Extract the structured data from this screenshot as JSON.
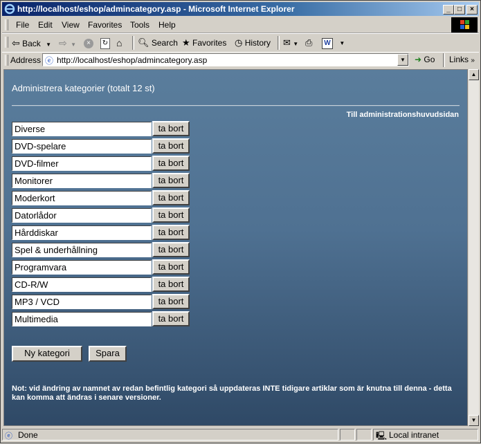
{
  "window": {
    "title": "http://localhost/eshop/admincategory.asp - Microsoft Internet Explorer"
  },
  "menu": {
    "items": [
      "File",
      "Edit",
      "View",
      "Favorites",
      "Tools",
      "Help"
    ]
  },
  "toolbar": {
    "back_label": "Back",
    "search_label": "Search",
    "favorites_label": "Favorites",
    "history_label": "History"
  },
  "address": {
    "label": "Address",
    "url": "http://localhost/eshop/admincategory.asp",
    "go_label": "Go",
    "links_label": "Links"
  },
  "page": {
    "title": "Administrera kategorier (totalt 12 st)",
    "admin_link": "Till administrationshuvudsidan",
    "delete_label": "ta bort",
    "categories": [
      "Diverse",
      "DVD-spelare",
      "DVD-filmer",
      "Monitorer",
      "Moderkort",
      "Datorlådor",
      "Hårddiskar",
      "Spel  & underhållning",
      "Programvara",
      "CD-R/W",
      "MP3 / VCD",
      "Multimedia"
    ],
    "new_category_label": "Ny kategori",
    "save_label": "Spara",
    "note": "Not: vid ändring av namnet av redan befintlig kategori så uppdateras INTE tidigare artiklar som är knutna till denna - detta kan komma att ändras i senare versioner."
  },
  "status": {
    "text": "Done",
    "zone": "Local intranet"
  }
}
